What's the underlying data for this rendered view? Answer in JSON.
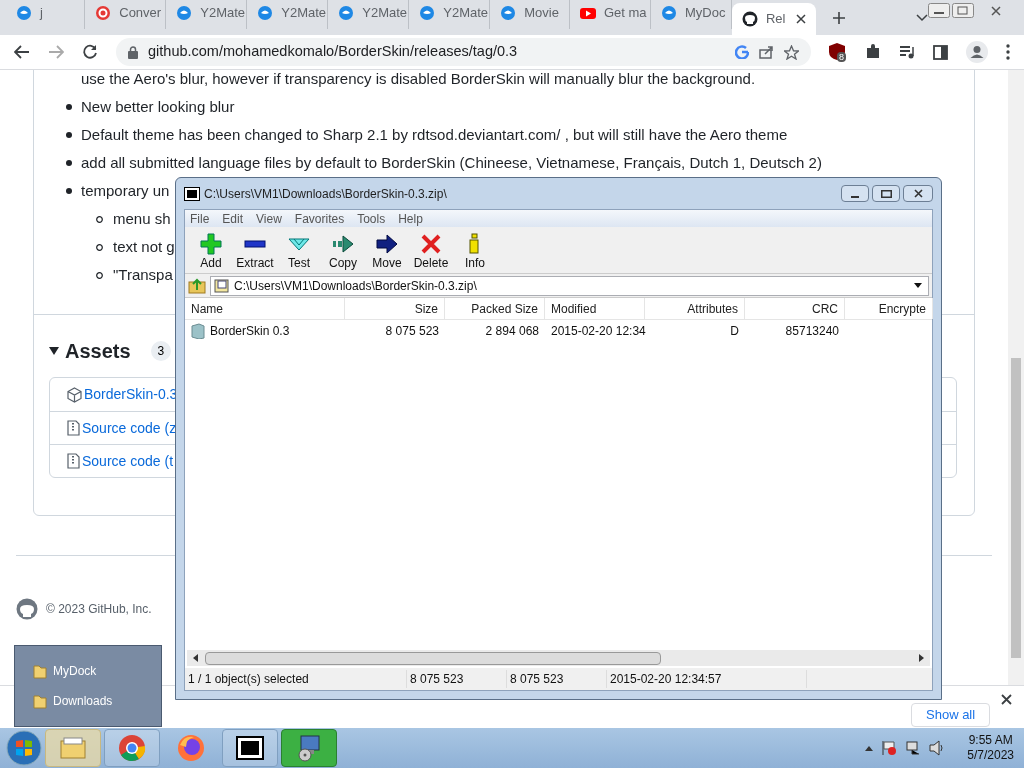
{
  "browser": {
    "tabs": [
      {
        "title": "j",
        "kind": "y2mate",
        "selected": false
      },
      {
        "title": "Conver",
        "kind": "convert",
        "selected": false
      },
      {
        "title": "Y2Mate",
        "kind": "y2mate",
        "selected": false
      },
      {
        "title": "Y2Mate",
        "kind": "y2mate",
        "selected": false
      },
      {
        "title": "Y2Mate",
        "kind": "y2mate",
        "selected": false
      },
      {
        "title": "Y2Mate",
        "kind": "y2mate",
        "selected": false
      },
      {
        "title": "Movie",
        "kind": "y2mate",
        "selected": false
      },
      {
        "title": "Get ma",
        "kind": "youtube",
        "selected": false
      },
      {
        "title": "MyDoc",
        "kind": "y2mate",
        "selected": false
      },
      {
        "title": "Rel",
        "kind": "github",
        "selected": true
      }
    ],
    "url": "github.com/mohamedkomalo/BorderSkin/releases/tag/0.3",
    "extension_badge": "8"
  },
  "page": {
    "intro": "use the Aero's blur, however if transparency is disabled BorderSkin will manually blur the background.",
    "bullets": [
      {
        "text": "New better looking blur"
      },
      {
        "text": "Default theme has been changed to Sharp 2.1 by rdtsod.deviantart.com/ , but will still have the Aero theme"
      },
      {
        "text": "add all submitted language files by default to BorderSkin (Chineese, Vietnamese, Français, Dutch 1, Deutsch 2)"
      },
      {
        "text": "temporary un",
        "children": [
          {
            "text": "menu sh"
          },
          {
            "text": "text not g"
          },
          {
            "text": "\"Transpa"
          }
        ]
      }
    ],
    "assets": {
      "title": "Assets",
      "count": "3",
      "items": [
        {
          "label": "BorderSkin-0.3",
          "kind": "package"
        },
        {
          "label": "Source code (z",
          "kind": "zip"
        },
        {
          "label": "Source code (t",
          "kind": "zip"
        }
      ]
    },
    "footer": "© 2023 GitHub, Inc.",
    "downloads": {
      "show_all": "Show all"
    }
  },
  "archiver": {
    "title": "C:\\Users\\VM1\\Downloads\\BorderSkin-0.3.zip\\",
    "menu": [
      "File",
      "Edit",
      "View",
      "Favorites",
      "Tools",
      "Help"
    ],
    "toolbar": [
      {
        "label": "Add",
        "kind": "add"
      },
      {
        "label": "Extract",
        "kind": "extract"
      },
      {
        "label": "Test",
        "kind": "test"
      },
      {
        "label": "Copy",
        "kind": "copy"
      },
      {
        "label": "Move",
        "kind": "move"
      },
      {
        "label": "Delete",
        "kind": "delete"
      },
      {
        "label": "Info",
        "kind": "info"
      }
    ],
    "path": "C:\\Users\\VM1\\Downloads\\BorderSkin-0.3.zip\\",
    "columns": [
      "Name",
      "Size",
      "Packed Size",
      "Modified",
      "Attributes",
      "CRC",
      "Encrypte"
    ],
    "rows": [
      [
        "BorderSkin 0.3",
        "8 075 523",
        "2 894 068",
        "2015-02-20 12:34",
        "D",
        "85713240",
        ""
      ]
    ],
    "status": [
      "1 / 1 object(s) selected",
      "8 075 523",
      "8 075 523",
      "2015-02-20 12:34:57"
    ]
  },
  "jump_list": [
    "MyDock",
    "Downloads"
  ],
  "taskbar": {
    "apps": [
      {
        "kind": "explorer"
      },
      {
        "kind": "chrome"
      },
      {
        "kind": "firefox"
      },
      {
        "kind": "sevenzip"
      },
      {
        "kind": "installer"
      }
    ],
    "time": "9:55 AM",
    "date": "5/7/2023"
  }
}
